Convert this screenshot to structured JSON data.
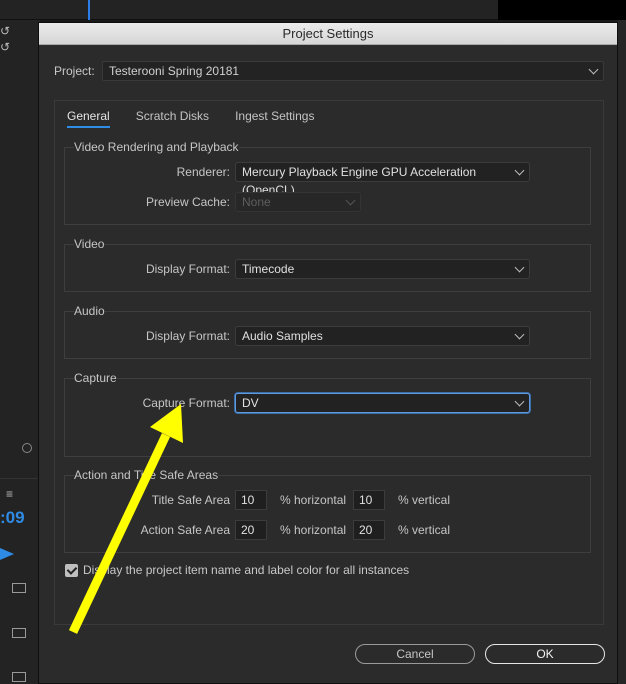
{
  "background": {
    "undo_glyph": "↺",
    "menu_glyph": "≡",
    "timecode_fragment": ":09"
  },
  "dialog": {
    "title": "Project Settings",
    "project_label": "Project:",
    "project_value": "Testerooni Spring 20181",
    "tabs": [
      "General",
      "Scratch Disks",
      "Ingest Settings"
    ],
    "active_tab": "General",
    "video_rendering": {
      "title": "Video Rendering and Playback",
      "renderer_label": "Renderer:",
      "renderer_value": "Mercury Playback Engine GPU Acceleration (OpenCL)",
      "preview_cache_label": "Preview Cache:",
      "preview_cache_value": "None"
    },
    "video": {
      "title": "Video",
      "display_format_label": "Display Format:",
      "display_format_value": "Timecode"
    },
    "audio": {
      "title": "Audio",
      "display_format_label": "Display Format:",
      "display_format_value": "Audio Samples"
    },
    "capture": {
      "title": "Capture",
      "capture_format_label": "Capture Format:",
      "capture_format_value": "DV"
    },
    "safe_areas": {
      "title": "Action and Title Safe Areas",
      "title_safe_label": "Title Safe Area",
      "title_safe_horizontal": "10",
      "title_safe_vertical": "10",
      "action_safe_label": "Action Safe Area",
      "action_safe_horizontal": "20",
      "action_safe_vertical": "20",
      "horizontal_unit": "% horizontal",
      "vertical_unit": "% vertical"
    },
    "checkbox_label": "Display the project item name and label color for all instances",
    "checkbox_checked": true,
    "cancel_label": "Cancel",
    "ok_label": "OK"
  },
  "annotation": {
    "arrow_color": "#ffff00"
  },
  "colors": {
    "accent": "#2e8ce6",
    "dialog_bg": "#2b2b2b"
  }
}
